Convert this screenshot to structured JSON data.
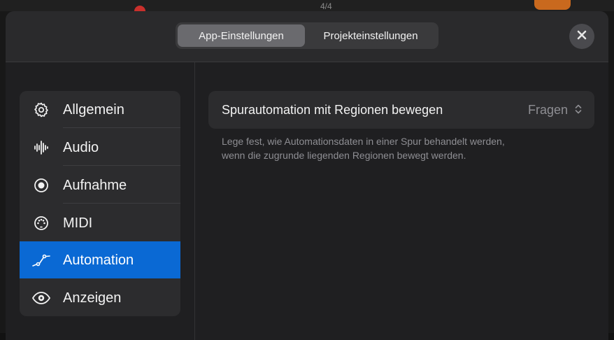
{
  "backdrop": {
    "top_indicator": "4/4"
  },
  "header": {
    "tabs": [
      {
        "label": "App-Einstellungen",
        "active": true
      },
      {
        "label": "Projekteinstellungen",
        "active": false
      }
    ],
    "close_icon": "close-icon"
  },
  "sidebar": {
    "items": [
      {
        "label": "Allgemein",
        "icon": "gear-icon",
        "selected": false
      },
      {
        "label": "Audio",
        "icon": "waveform-icon",
        "selected": false
      },
      {
        "label": "Aufnahme",
        "icon": "record-icon",
        "selected": false
      },
      {
        "label": "MIDI",
        "icon": "midi-icon",
        "selected": false
      },
      {
        "label": "Automation",
        "icon": "automation-icon",
        "selected": true
      },
      {
        "label": "Anzeigen",
        "icon": "eye-icon",
        "selected": false
      }
    ]
  },
  "main": {
    "setting": {
      "label": "Spurautomation mit Regionen bewegen",
      "value": "Fragen"
    },
    "help_line_1": "Lege fest, wie Automationsdaten in einer Spur behandelt werden,",
    "help_line_2": "wenn die zugrunde liegenden Regionen bewegt werden."
  },
  "colors": {
    "accent": "#0a69d4",
    "sheet_background": "#1f1f21",
    "row_background": "#2c2c2e",
    "secondary_text": "#8e8e93"
  }
}
